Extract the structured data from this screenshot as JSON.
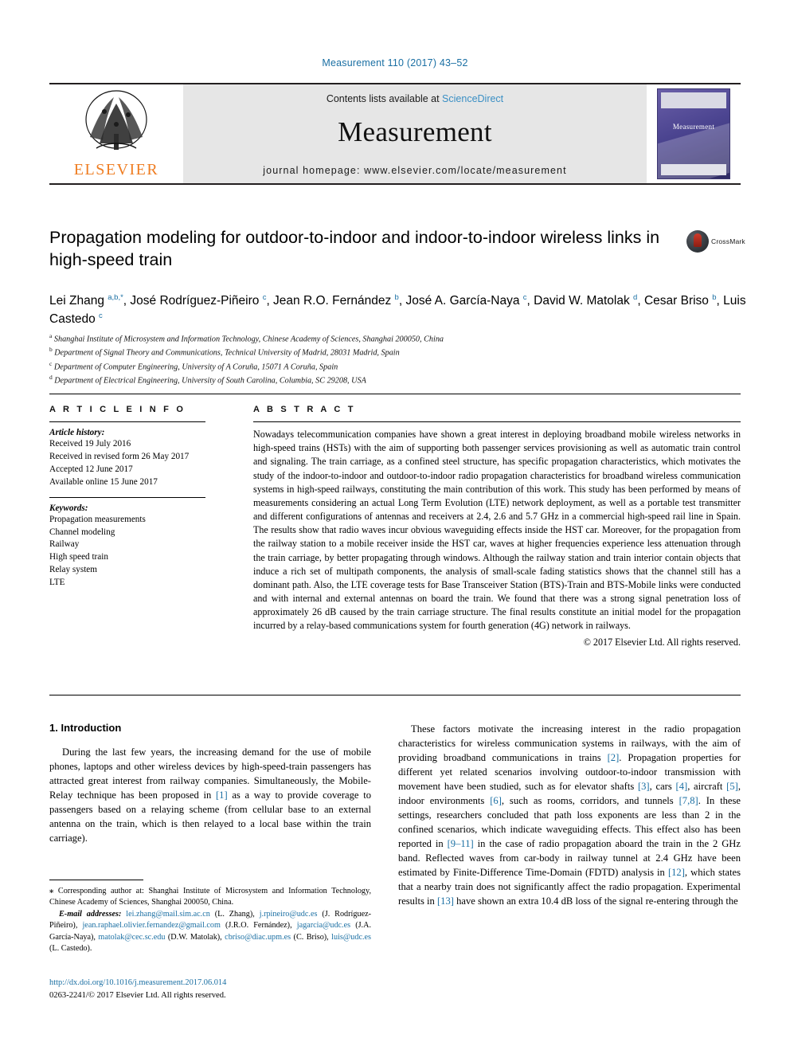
{
  "running_head": "Measurement 110 (2017) 43–52",
  "masthead": {
    "contents_prefix": "Contents lists available at ",
    "contents_link": "ScienceDirect",
    "journal_title": "Measurement",
    "homepage": "journal homepage: www.elsevier.com/locate/measurement",
    "publisher_wordmark": "ELSEVIER",
    "cover_title": "Measurement"
  },
  "article": {
    "title": "Propagation modeling for outdoor-to-indoor and indoor-to-indoor wireless links in high-speed train",
    "crossmark_label": "CrossMark",
    "authors_html": "Lei Zhang <sup>a,b,*</sup>, José Rodríguez-Piñeiro <sup>c</sup>, Jean R.O. Fernández <sup>b</sup>, José A. García-Naya <sup>c</sup>, David W. Matolak <sup>d</sup>, Cesar Briso <sup>b</sup>, Luis Castedo <sup>c</sup>",
    "affiliations": [
      {
        "marker": "a",
        "text": "Shanghai Institute of Microsystem and Information Technology, Chinese Academy of Sciences, Shanghai 200050, China"
      },
      {
        "marker": "b",
        "text": "Department of Signal Theory and Communications, Technical University of Madrid, 28031 Madrid, Spain"
      },
      {
        "marker": "c",
        "text": "Department of Computer Engineering, University of A Coruña, 15071 A Coruña, Spain"
      },
      {
        "marker": "d",
        "text": "Department of Electrical Engineering, University of South Carolina, Columbia, SC 29208, USA"
      }
    ]
  },
  "article_info": {
    "heading": "A R T I C L E   I N F O",
    "history_label": "Article history:",
    "history": [
      "Received 19 July 2016",
      "Received in revised form 26 May 2017",
      "Accepted 12 June 2017",
      "Available online 15 June 2017"
    ],
    "keywords_label": "Keywords:",
    "keywords": [
      "Propagation measurements",
      "Channel modeling",
      "Railway",
      "High speed train",
      "Relay system",
      "LTE"
    ]
  },
  "abstract": {
    "heading": "A B S T R A C T",
    "text": "Nowadays telecommunication companies have shown a great interest in deploying broadband mobile wireless networks in high-speed trains (HSTs) with the aim of supporting both passenger services provisioning as well as automatic train control and signaling. The train carriage, as a confined steel structure, has specific propagation characteristics, which motivates the study of the indoor-to-indoor and outdoor-to-indoor radio propagation characteristics for broadband wireless communication systems in high-speed railways, constituting the main contribution of this work. This study has been performed by means of measurements considering an actual Long Term Evolution (LTE) network deployment, as well as a portable test transmitter and different configurations of antennas and receivers at 2.4, 2.6 and 5.7 GHz in a commercial high-speed rail line in Spain. The results show that radio waves incur obvious waveguiding effects inside the HST car. Moreover, for the propagation from the railway station to a mobile receiver inside the HST car, waves at higher frequencies experience less attenuation through the train carriage, by better propagating through windows. Although the railway station and train interior contain objects that induce a rich set of multipath components, the analysis of small-scale fading statistics shows that the channel still has a dominant path. Also, the LTE coverage tests for Base Transceiver Station (BTS)-Train and BTS-Mobile links were conducted and with internal and external antennas on board the train. We found that there was a strong signal penetration loss of approximately 26 dB caused by the train carriage structure. The final results constitute an initial model for the propagation incurred by a relay-based communications system for fourth generation (4G) network in railways.",
    "copyright": "© 2017 Elsevier Ltd. All rights reserved."
  },
  "body": {
    "section_heading": "1. Introduction",
    "left_paragraph_html": "During the last few years, the increasing demand for the use of mobile phones, laptops and other wireless devices by high-speed-train passengers has attracted great interest from railway companies. Simultaneously, the Mobile-Relay technique has been proposed in <span class=\"ref\">[1]</span> as a way to provide coverage to passengers based on a relaying scheme (from cellular base to an external antenna on the train, which is then relayed to a local base within the train carriage).",
    "right_paragraph_html": "These factors motivate the increasing interest in the radio propagation characteristics for wireless communication systems in railways, with the aim of providing broadband communications in trains <span class=\"ref\">[2]</span>. Propagation properties for different yet related scenarios involving outdoor-to-indoor transmission with movement have been studied, such as for elevator shafts <span class=\"ref\">[3]</span>, cars <span class=\"ref\">[4]</span>, aircraft <span class=\"ref\">[5]</span>, indoor environments <span class=\"ref\">[6]</span>, such as rooms, corridors, and tunnels <span class=\"ref\">[7,8]</span>. In these settings, researchers concluded that path loss exponents are less than 2 in the confined scenarios, which indicate waveguiding effects. This effect also has been reported in <span class=\"ref\">[9–11]</span> in the case of radio propagation aboard the train in the 2 GHz band. Reflected waves from car-body in railway tunnel at 2.4 GHz have been estimated by Finite-Difference Time-Domain (FDTD) analysis in <span class=\"ref\">[12]</span>, which states that a nearby train does not significantly affect the radio propagation. Experimental results in <span class=\"ref\">[13]</span> have shown an extra 10.4 dB loss of the signal re-entering through the"
  },
  "footnotes": {
    "corresponding_html": "<span class=\"em\">⁎</span> Corresponding author at: Shanghai Institute of Microsystem and Information Technology, Chinese Academy of Sciences, Shanghai 200050, China.",
    "emails_html": "<span class=\"em\">E-mail addresses:</span> <span class=\"mail\">lei.zhang@mail.sim.ac.cn</span> (L. Zhang), <span class=\"mail\">j.rpineiro@udc.es</span> (J. Rodríguez-Piñeiro), <span class=\"mail\">jean.raphael.olivier.fernandez@gmail.com</span> (J.R.O. Fernández), <span class=\"mail\">jagarcia@udc.es</span> (J.A. García-Naya), <span class=\"mail\">matolak@cec.sc.edu</span> (D.W. Matolak), <span class=\"mail\">cbriso@diac.upm.es</span> (C. Briso), <span class=\"mail\">luis@udc.es</span> (L. Castedo).",
    "doi": "http://dx.doi.org/10.1016/j.measurement.2017.06.014",
    "issn": "0263-2241/© 2017 Elsevier Ltd. All rights reserved."
  }
}
